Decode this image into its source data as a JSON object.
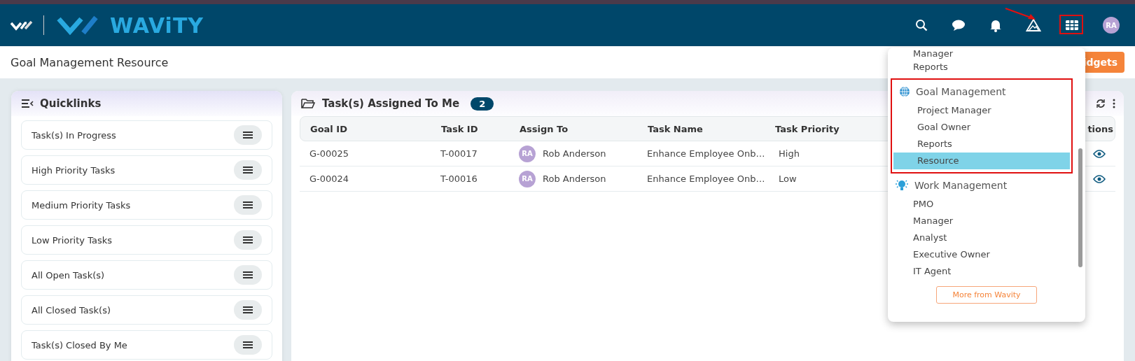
{
  "header": {
    "brand": "WAViTY",
    "avatar": "RA"
  },
  "page_title": "Goal Management Resource",
  "widgets_button": "idgets",
  "quicklinks": {
    "title": "Quicklinks",
    "items": [
      "Task(s) In Progress",
      "High Priority Tasks",
      "Medium Priority Tasks",
      "Low Priority Tasks",
      "All Open Task(s)",
      "All Closed Task(s)",
      "Task(s) Closed By Me"
    ]
  },
  "tasks": {
    "title": "Task(s) Assigned To Me",
    "count": "2",
    "columns": [
      "Goal ID",
      "Task ID",
      "Assign To",
      "Task Name",
      "Task Priority",
      "tions"
    ],
    "rows": [
      {
        "goal_id": "G-00025",
        "task_id": "T-00017",
        "avatar": "RA",
        "assignee": "Rob Anderson",
        "task_name": "Enhance Employee Onb…",
        "priority": "High"
      },
      {
        "goal_id": "G-00024",
        "task_id": "T-00016",
        "avatar": "RA",
        "assignee": "Rob Anderson",
        "task_name": "Enhance Employee Onb…",
        "priority": "Low"
      }
    ]
  },
  "app_menu": {
    "sections": [
      {
        "kind": "plain",
        "items": [
          {
            "label": "Manager",
            "selected": false
          },
          {
            "label": "Reports",
            "selected": false
          }
        ]
      },
      {
        "kind": "globe",
        "title": "Goal Management",
        "items": [
          {
            "label": "Project Manager",
            "selected": false
          },
          {
            "label": "Goal Owner",
            "selected": false
          },
          {
            "label": "Reports",
            "selected": false
          },
          {
            "label": "Resource",
            "selected": true
          }
        ]
      },
      {
        "kind": "bulb",
        "title": "Work Management",
        "items": [
          {
            "label": "PMO",
            "selected": false
          },
          {
            "label": "Manager",
            "selected": false
          },
          {
            "label": "Analyst",
            "selected": false
          },
          {
            "label": "Executive Owner",
            "selected": false
          },
          {
            "label": "IT Agent",
            "selected": false
          }
        ]
      }
    ],
    "more_button": "More from Wavity"
  }
}
